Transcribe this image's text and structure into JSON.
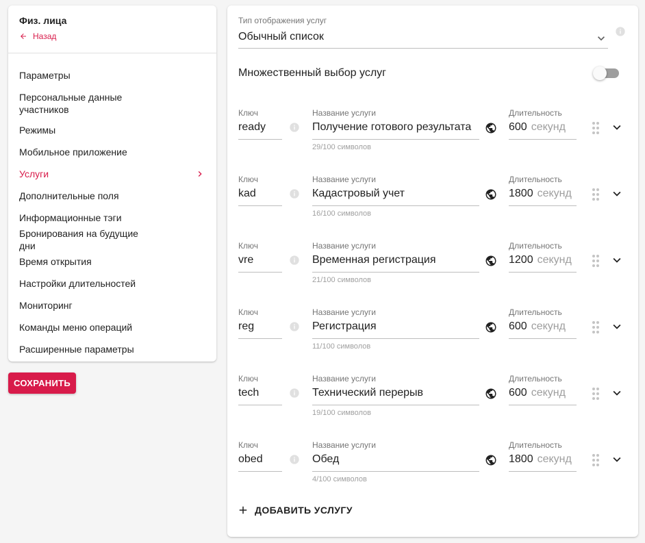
{
  "sidebar": {
    "title": "Физ. лица",
    "back_label": "Назад",
    "items": [
      {
        "label": "Параметры",
        "active": false
      },
      {
        "label": "Персональные данные участников",
        "active": false
      },
      {
        "label": "Режимы",
        "active": false
      },
      {
        "label": "Мобильное приложение",
        "active": false
      },
      {
        "label": "Услуги",
        "active": true
      },
      {
        "label": "Дополнительные поля",
        "active": false
      },
      {
        "label": "Информационные тэги",
        "active": false
      },
      {
        "label": "Бронирования на будущие дни",
        "active": false
      },
      {
        "label": "Время открытия",
        "active": false
      },
      {
        "label": "Настройки длительностей",
        "active": false
      },
      {
        "label": "Мониторинг",
        "active": false
      },
      {
        "label": "Команды меню операций",
        "active": false
      },
      {
        "label": "Расширенные параметры",
        "active": false
      }
    ]
  },
  "save_label": "СОХРАНИТЬ",
  "display_type": {
    "label": "Тип отображения услуг",
    "value": "Обычный список"
  },
  "multi_select": {
    "label": "Множественный выбор услуг",
    "enabled": false
  },
  "service_labels": {
    "key": "Ключ",
    "name": "Название услуги",
    "duration": "Длительность"
  },
  "services": [
    {
      "key": "ready",
      "name": "Получение готового результата",
      "counter": "29/100 символов",
      "duration": "600",
      "unit": "секунд"
    },
    {
      "key": "kad",
      "name": "Кадастровый учет",
      "counter": "16/100 символов",
      "duration": "1800",
      "unit": "секунд"
    },
    {
      "key": "vre",
      "name": "Временная регистрация",
      "counter": "21/100 символов",
      "duration": "1200",
      "unit": "секунд"
    },
    {
      "key": "reg",
      "name": "Регистрация",
      "counter": "11/100 символов",
      "duration": "600",
      "unit": "секунд"
    },
    {
      "key": "tech",
      "name": "Технический перерыв",
      "counter": "19/100 символов",
      "duration": "600",
      "unit": "секунд"
    },
    {
      "key": "obed",
      "name": "Обед",
      "counter": "4/100 символов",
      "duration": "1800",
      "unit": "секунд"
    }
  ],
  "add_service_label": "ДОБАВИТЬ УСЛУГУ",
  "colors": {
    "accent": "#d81b4a",
    "text": "#212121",
    "muted": "#757575"
  },
  "icons": {
    "back": "arrow-left-icon",
    "nav_active": "chevron-right-icon",
    "select": "chevron-down-icon",
    "info": "info-icon",
    "translate": "globe-icon",
    "drag": "drag-handle-icon",
    "expand": "chevron-down-icon",
    "add": "plus-icon"
  }
}
